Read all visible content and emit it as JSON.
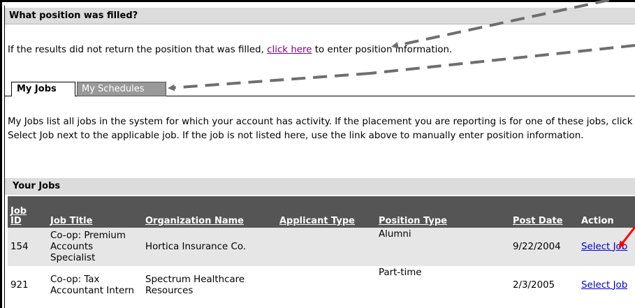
{
  "section": {
    "title": "What position was filled?"
  },
  "results": {
    "prefix": "If the results did not return the position that was filled, ",
    "link": "click here",
    "suffix": " to enter position information."
  },
  "tabs": [
    {
      "label": "My Jobs",
      "active": true
    },
    {
      "label": "My Schedules",
      "active": false
    }
  ],
  "description": "My Jobs list all jobs in the system for which your account has activity.  If the placement you are reporting is for one of these jobs, click Select Job next to the applicable job.  If the job is not listed here, use the link above to manually enter position information.",
  "jobs": {
    "title": "Your Jobs",
    "columns": [
      "Job ID",
      "Job Title",
      "Organization Name",
      "Applicant Type",
      "Position Type",
      "Post Date",
      "Action"
    ],
    "rows": [
      {
        "id": "154",
        "title": "Co-op: Premium Accounts Specialist",
        "organization": "Hortica Insurance Co.",
        "applicant_type": "",
        "position_type": "Alumni",
        "post_date": "9/22/2004",
        "action": "Select Job"
      },
      {
        "id": "921",
        "title": "Co-op: Tax Accountant Intern",
        "organization": "Spectrum Healthcare Resources",
        "applicant_type": "",
        "position_type": "Part-time",
        "post_date": "2/3/2005",
        "action": "Select Job"
      }
    ]
  },
  "colors": {
    "header_bg": "#dcdcdc",
    "table_header_bg": "#555555",
    "row_alt_bg": "#e6e6e6",
    "visited_link": "#800080",
    "link": "#0000cc",
    "arrow_gray": "#6e6e6e",
    "arrow_red": "#ff0000"
  }
}
